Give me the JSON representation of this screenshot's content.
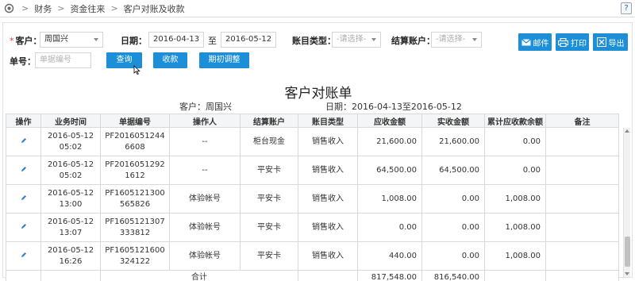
{
  "breadcrumb": {
    "items": [
      "财务",
      "资金往来",
      "客户对账及收款"
    ],
    "separator": ">"
  },
  "help_label": "?",
  "filters": {
    "customer_label": "客户：",
    "customer_required": "*",
    "customer_value": "周国兴",
    "date_label": "日期：",
    "date_from": "2016-04-13",
    "date_to_sep": "至",
    "date_to": "2016-05-12",
    "account_type_label": "账目类型：",
    "account_type_placeholder": "-请选择-",
    "settle_account_label": "结算账户：",
    "settle_account_placeholder": "-请选择-",
    "doc_no_label": "单号：",
    "doc_no_placeholder": "单据编号"
  },
  "buttons": {
    "query": "查询",
    "collect": "收款",
    "initial_adjust": "期初调整",
    "mail": "邮件",
    "print": "打印",
    "export": "导出"
  },
  "report": {
    "title": "客户对账单",
    "customer_info": "客户：周国兴",
    "date_info": "日期：2016-04-13至2016-05-12"
  },
  "table": {
    "headers": [
      "操作",
      "业务时间",
      "单据编号",
      "操作人",
      "结算账户",
      "账目类型",
      "应收金额",
      "实收金额",
      "累计应收款余额",
      "备注"
    ],
    "rows": [
      {
        "time": "2016-05-12 05:02",
        "doc": "PF2016051244 6608",
        "operator": "--",
        "account": "柜台现金",
        "type": "销售收入",
        "receivable": "21,600.00",
        "received": "21,600.00",
        "balance": "0.00",
        "note": ""
      },
      {
        "time": "2016-05-12 05:02",
        "doc": "PF2016051292 1612",
        "operator": "--",
        "account": "平安卡",
        "type": "销售收入",
        "receivable": "64,500.00",
        "received": "64,500.00",
        "balance": "0.00",
        "note": ""
      },
      {
        "time": "2016-05-12 13:00",
        "doc": "PF1605121300 565826",
        "operator": "体验帐号",
        "account": "平安卡",
        "type": "销售收入",
        "receivable": "1,008.00",
        "received": "0.00",
        "balance": "1,008.00",
        "note": ""
      },
      {
        "time": "2016-05-12 13:07",
        "doc": "PF1605121307 333812",
        "operator": "体验帐号",
        "account": "平安卡",
        "type": "销售收入",
        "receivable": "0.00",
        "received": "0.00",
        "balance": "1,008.00",
        "note": ""
      },
      {
        "time": "2016-05-12 16:26",
        "doc": "PF1605121600 324122",
        "operator": "体验帐号",
        "account": "平安卡",
        "type": "销售收入",
        "receivable": "440.00",
        "received": "0.00",
        "balance": "1,008.00",
        "note": ""
      }
    ],
    "total_label": "合计",
    "total_receivable": "817,548.00",
    "total_received": "816,540.00"
  },
  "colors": {
    "accent": "#1d8fd8",
    "required": "#e23c3c",
    "border": "#d6dadd"
  },
  "icons": [
    "home-icon",
    "edit-icon",
    "mail-icon",
    "print-icon",
    "export-icon",
    "dropdown-caret-icon",
    "cursor-icon"
  ]
}
